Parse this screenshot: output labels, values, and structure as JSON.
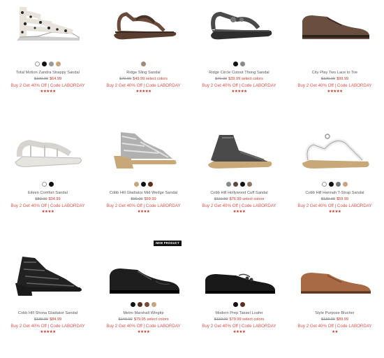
{
  "badge": "NEW PRODUCT",
  "products": [
    {
      "name": "Total Motion Zandra Strappy Sandal",
      "old": "$100.00",
      "new": "$64.99",
      "promo": "Buy 2 Get 40% Off | Code LABORDAY",
      "stars": "★★★★★",
      "swatches": [
        "#ffffff",
        "#111111",
        "#9a9a9a",
        "#c9a27e"
      ],
      "icon": "leopard-strappy-sandal-icon"
    },
    {
      "name": "Ridge Sling Sandal",
      "old": "$70.00",
      "new": "$49.99 select colors",
      "promo": "Buy 2 Get 40% Off | Code LABORDAY",
      "stars": "★★★★★",
      "swatches": [
        "#a08a78"
      ],
      "icon": "brown-sling-sandal-icon"
    },
    {
      "name": "Ridge Circle Cutout Thong Sandal",
      "old": "$70.00",
      "new": "$39.99 select colors",
      "promo": "Buy 2 Get 40% Off | Code LABORDAY",
      "stars": "★★★★★",
      "swatches": [
        "#111111",
        "#8a8a8a"
      ],
      "icon": "thong-sandal-icon"
    },
    {
      "name": "City Play Two Lace to Toe",
      "old": "$120.00",
      "new": "$99.99",
      "promo": "Buy 2 Get 40% Off | Code LABORDAY",
      "stars": "★★★★★",
      "swatches": [],
      "icon": "brown-lace-shoe-icon"
    },
    {
      "name": "Eileen Comfort Sandal",
      "old": "$80.00",
      "new": "$34.99",
      "promo": "Buy 2 Get 40% Off | Code LABORDAY",
      "stars": "★★★★",
      "swatches": [
        "#ffffff",
        "#111111"
      ],
      "icon": "white-comfort-sandal-icon"
    },
    {
      "name": "Cobb Hill Gladiator Mid Wedge Sandal",
      "old": "$90.00",
      "new": "$59.99",
      "promo": "Buy 2 Get 40% Off | Code LABORDAY",
      "stars": "★★★★",
      "swatches": [
        "#c9a27e",
        "#111111",
        "#5a2f22"
      ],
      "icon": "silver-wedge-sandal-icon"
    },
    {
      "name": "Cobb Hill Hollywood Cuff Sandal",
      "old": "$110.00",
      "new": "$76.99 select colors",
      "promo": "Buy 2 Get 40% Off | Code LABORDAY",
      "stars": "★★★★",
      "swatches": [
        "#8a8a8a",
        "#5a4a42",
        "#111111",
        "#8a7565"
      ],
      "icon": "gray-cuff-sandal-icon"
    },
    {
      "name": "Cobb Hill Hannah T-Strap Sandal",
      "old": "$130.00",
      "new": "$59.99",
      "promo": "Buy 2 Get 40% Off | Code LABORDAY",
      "stars": "★★★★",
      "swatches": [
        "#ffffff",
        "#111111",
        "#777777",
        "#c9a27e"
      ],
      "icon": "white-tstrap-sandal-icon"
    },
    {
      "name": "Cobb Hill Shona Gladiator Sandal",
      "old": "$130.00",
      "new": "$84.99",
      "promo": "Buy 2 Get 40% Off | Code LABORDAY",
      "stars": "★★★★★",
      "swatches": [],
      "icon": "black-gladiator-sandal-icon"
    },
    {
      "name": "Metro Marshall Wingtip",
      "old": "$140.00",
      "new": "$79.95 select colors",
      "promo": "Buy 2 Get 40% Off | Code LABORDAY",
      "stars": "★★★★",
      "swatches": [
        "#111111",
        "#5a2f22",
        "#7a4a3a",
        "#c9a27e"
      ],
      "icon": "black-wingtip-icon"
    },
    {
      "name": "Modern Prep Tassel Loafer",
      "old": "$110.00",
      "new": "$79.99 select colors",
      "promo": "Buy 2 Get 40% Off | Code LABORDAY",
      "stars": "★★★★",
      "swatches": [
        "#111111",
        "#5a2f22"
      ],
      "icon": "tassel-loafer-icon"
    },
    {
      "name": "Style Purpose Blucher",
      "old": "$110.00",
      "new": "$89.99",
      "promo": "Buy 2 Get 40% Off | Code LABORDAY",
      "stars": "★★",
      "swatches": [],
      "icon": "tan-blucher-icon"
    }
  ]
}
